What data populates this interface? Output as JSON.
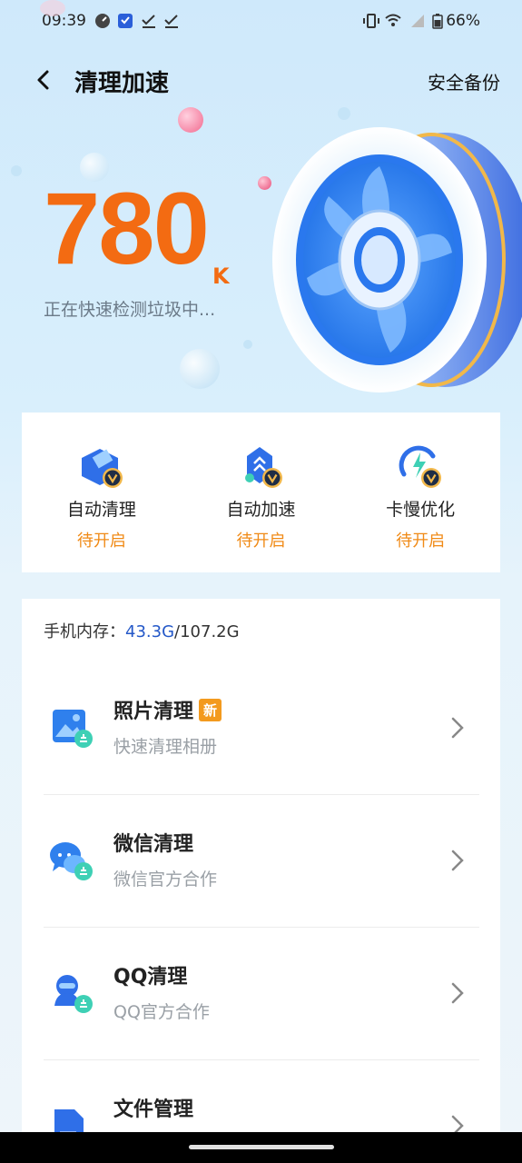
{
  "status_bar": {
    "time": "09:39",
    "battery": "66%",
    "icons": [
      "speedometer-icon",
      "shield-icon",
      "check-icon",
      "check-icon",
      "vibrate-icon",
      "wifi-icon",
      "signal-icon",
      "battery-icon"
    ]
  },
  "header": {
    "title": "清理加速",
    "backup_label": "安全备份"
  },
  "hero": {
    "junk_amount": "780",
    "junk_unit": "K",
    "status_text": "正在快速检测垃圾中..."
  },
  "features": [
    {
      "label": "自动清理",
      "status": "待开启",
      "icon": "auto-clean-icon"
    },
    {
      "label": "自动加速",
      "status": "待开启",
      "icon": "auto-speed-icon"
    },
    {
      "label": "卡慢优化",
      "status": "待开启",
      "icon": "lag-optimize-icon"
    }
  ],
  "storage": {
    "label": "手机内存：",
    "used": "43.3G",
    "total": "/107.2G"
  },
  "clean_items": [
    {
      "title": "照片清理",
      "badge": "新",
      "subtitle": "快速清理相册",
      "icon": "photo-icon"
    },
    {
      "title": "微信清理",
      "subtitle": "微信官方合作",
      "icon": "wechat-icon"
    },
    {
      "title": "QQ清理",
      "subtitle": "QQ官方合作",
      "icon": "qq-icon"
    },
    {
      "title": "文件管理",
      "subtitle": "",
      "icon": "file-icon"
    }
  ],
  "colors": {
    "accent_orange": "#f36b12",
    "status_orange": "#f08a16",
    "used_blue": "#2458c8",
    "badge": "#f39a1e"
  }
}
